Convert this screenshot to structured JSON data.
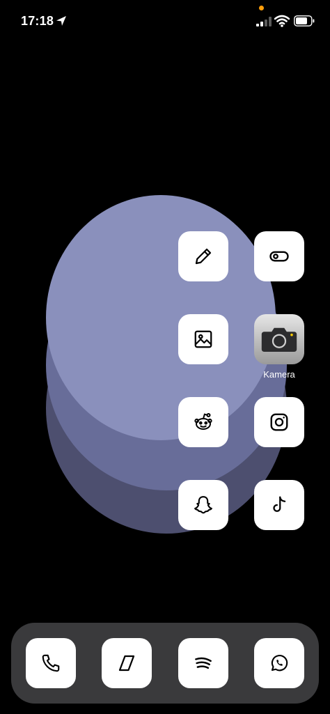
{
  "status_bar": {
    "time": "17:18"
  },
  "home": {
    "apps": [
      {
        "name": "pencil-app",
        "icon": "pencil-icon"
      },
      {
        "name": "toggle-app",
        "icon": "toggle-icon"
      },
      {
        "name": "photos-app",
        "icon": "image-icon"
      },
      {
        "name": "camera-app",
        "icon": "camera-icon",
        "label": "Kamera"
      },
      {
        "name": "reddit-app",
        "icon": "reddit-icon"
      },
      {
        "name": "instagram-app",
        "icon": "instagram-icon"
      },
      {
        "name": "snapchat-app",
        "icon": "snapchat-icon"
      },
      {
        "name": "tiktok-app",
        "icon": "tiktok-icon"
      }
    ]
  },
  "dock": {
    "apps": [
      {
        "name": "phone-app",
        "icon": "phone-icon"
      },
      {
        "name": "safari-app",
        "icon": "compass-icon"
      },
      {
        "name": "spotify-app",
        "icon": "spotify-icon"
      },
      {
        "name": "whatsapp-app",
        "icon": "whatsapp-icon"
      }
    ]
  },
  "colors": {
    "background": "#000000",
    "circle_light": "#8a90bc",
    "circle_mid": "#686d99",
    "circle_dark": "#4d4f6f",
    "dock": "#3a3a3c",
    "privacy_dot": "#ff9f0a"
  }
}
